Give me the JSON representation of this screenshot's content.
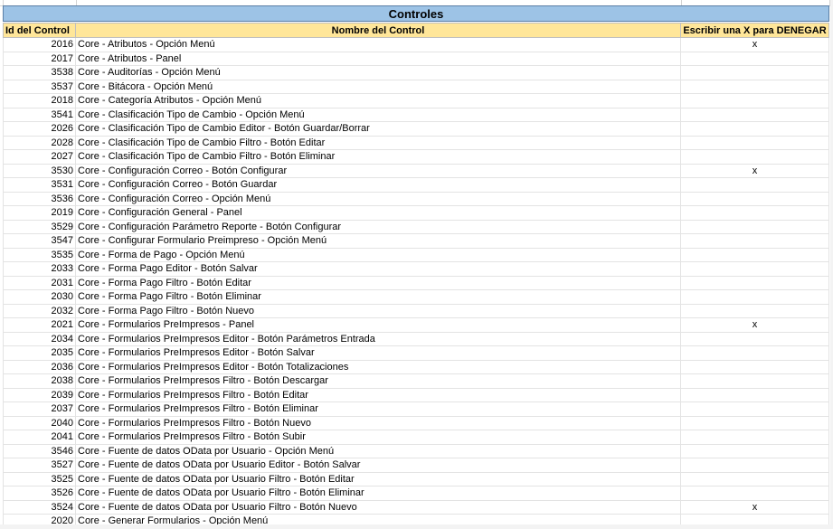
{
  "sheet": {
    "title": "Controles",
    "headers": {
      "id": "Id del Control",
      "name": "Nombre del Control",
      "deny": "Escribir una X para DENEGAR"
    },
    "rows": [
      {
        "id": "2016",
        "name": "Core - Atributos - Opción Menú",
        "deny": "x"
      },
      {
        "id": "2017",
        "name": "Core - Atributos - Panel",
        "deny": ""
      },
      {
        "id": "3538",
        "name": "Core - Auditorías - Opción Menú",
        "deny": ""
      },
      {
        "id": "3537",
        "name": "Core - Bitácora - Opción Menú",
        "deny": ""
      },
      {
        "id": "2018",
        "name": "Core - Categoría Atributos - Opción Menú",
        "deny": ""
      },
      {
        "id": "3541",
        "name": "Core - Clasificación Tipo de Cambio - Opción Menú",
        "deny": ""
      },
      {
        "id": "2026",
        "name": "Core - Clasificación Tipo de Cambio Editor - Botón Guardar/Borrar",
        "deny": ""
      },
      {
        "id": "2028",
        "name": "Core - Clasificación Tipo de Cambio Filtro - Botón Editar",
        "deny": ""
      },
      {
        "id": "2027",
        "name": "Core - Clasificación Tipo de Cambio Filtro - Botón Eliminar",
        "deny": ""
      },
      {
        "id": "3530",
        "name": "Core - Configuración Correo - Botón Configurar",
        "deny": "x"
      },
      {
        "id": "3531",
        "name": "Core - Configuración Correo - Botón Guardar",
        "deny": ""
      },
      {
        "id": "3536",
        "name": "Core - Configuración Correo - Opción Menú",
        "deny": ""
      },
      {
        "id": "2019",
        "name": "Core - Configuración General - Panel",
        "deny": ""
      },
      {
        "id": "3529",
        "name": "Core - Configuración Parámetro Reporte - Botón Configurar",
        "deny": ""
      },
      {
        "id": "3547",
        "name": "Core - Configurar Formulario Preimpreso - Opción Menú",
        "deny": ""
      },
      {
        "id": "3535",
        "name": "Core - Forma de Pago - Opción Menú",
        "deny": ""
      },
      {
        "id": "2033",
        "name": "Core - Forma Pago Editor - Botón Salvar",
        "deny": ""
      },
      {
        "id": "2031",
        "name": "Core - Forma Pago Filtro - Botón Editar",
        "deny": ""
      },
      {
        "id": "2030",
        "name": "Core - Forma Pago Filtro - Botón Eliminar",
        "deny": ""
      },
      {
        "id": "2032",
        "name": "Core - Forma Pago Filtro - Botón Nuevo",
        "deny": ""
      },
      {
        "id": "2021",
        "name": "Core - Formularios PreImpresos - Panel",
        "deny": "x"
      },
      {
        "id": "2034",
        "name": "Core - Formularios PreImpresos Editor - Botón Parámetros Entrada",
        "deny": ""
      },
      {
        "id": "2035",
        "name": "Core - Formularios PreImpresos Editor - Botón Salvar",
        "deny": ""
      },
      {
        "id": "2036",
        "name": "Core - Formularios PreImpresos Editor - Botón Totalizaciones",
        "deny": ""
      },
      {
        "id": "2038",
        "name": "Core - Formularios PreImpresos Filtro - Botón Descargar",
        "deny": ""
      },
      {
        "id": "2039",
        "name": "Core - Formularios PreImpresos Filtro - Botón Editar",
        "deny": ""
      },
      {
        "id": "2037",
        "name": "Core - Formularios PreImpresos Filtro - Botón Eliminar",
        "deny": ""
      },
      {
        "id": "2040",
        "name": "Core - Formularios PreImpresos Filtro - Botón Nuevo",
        "deny": ""
      },
      {
        "id": "2041",
        "name": "Core - Formularios PreImpresos Filtro - Botón Subir",
        "deny": ""
      },
      {
        "id": "3546",
        "name": "Core - Fuente de datos OData por Usuario - Opción Menú",
        "deny": ""
      },
      {
        "id": "3527",
        "name": "Core - Fuente de datos OData por Usuario Editor - Botón Salvar",
        "deny": ""
      },
      {
        "id": "3525",
        "name": "Core - Fuente de datos OData por Usuario Filtro - Botón Editar",
        "deny": ""
      },
      {
        "id": "3526",
        "name": "Core - Fuente de datos OData por Usuario Filtro - Botón Eliminar",
        "deny": ""
      },
      {
        "id": "3524",
        "name": "Core - Fuente de datos OData por Usuario Filtro - Botón Nuevo",
        "deny": "x"
      },
      {
        "id": "2020",
        "name": "Core - Generar Formularios - Opción Menú",
        "deny": ""
      }
    ]
  }
}
